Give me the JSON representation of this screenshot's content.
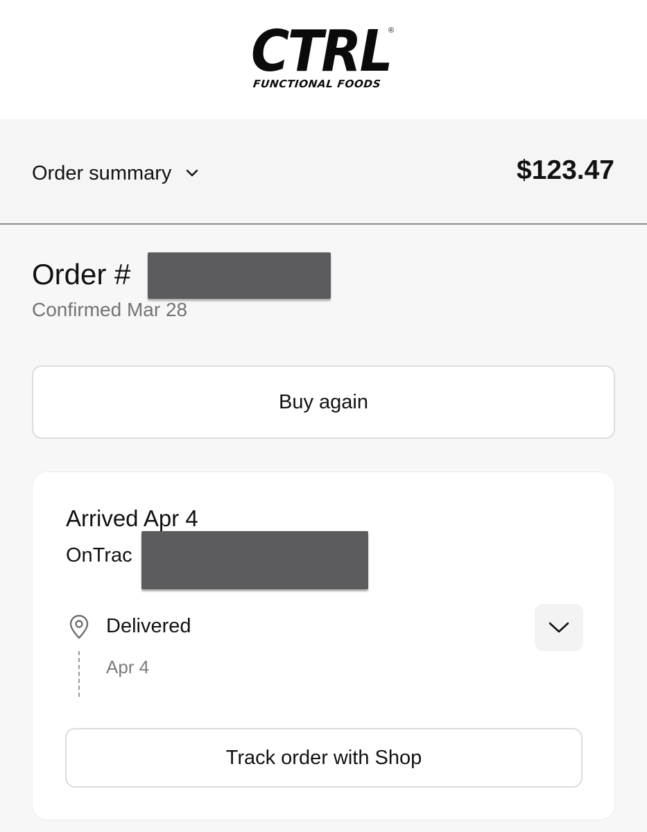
{
  "brand": {
    "name": "CTRL",
    "registered_mark": "®",
    "tagline": "FUNCTIONAL FOODS"
  },
  "summary": {
    "label": "Order summary",
    "total": "$123.47",
    "chevron_icon": "chevron-down-icon"
  },
  "order": {
    "title_prefix": "Order #",
    "confirmed": "Confirmed Mar 28"
  },
  "actions": {
    "buy_again": "Buy again"
  },
  "shipment": {
    "arrived": "Arrived Apr 4",
    "carrier": "OnTrac",
    "status": "Delivered",
    "status_date": "Apr 4",
    "status_icon": "location-pin-icon",
    "expand_icon": "chevron-down-icon",
    "track_button": "Track order with Shop"
  },
  "colors": {
    "background": "#f7f7f7",
    "card": "#ffffff",
    "muted_text": "#737373",
    "redaction": "#5c5c5e"
  }
}
